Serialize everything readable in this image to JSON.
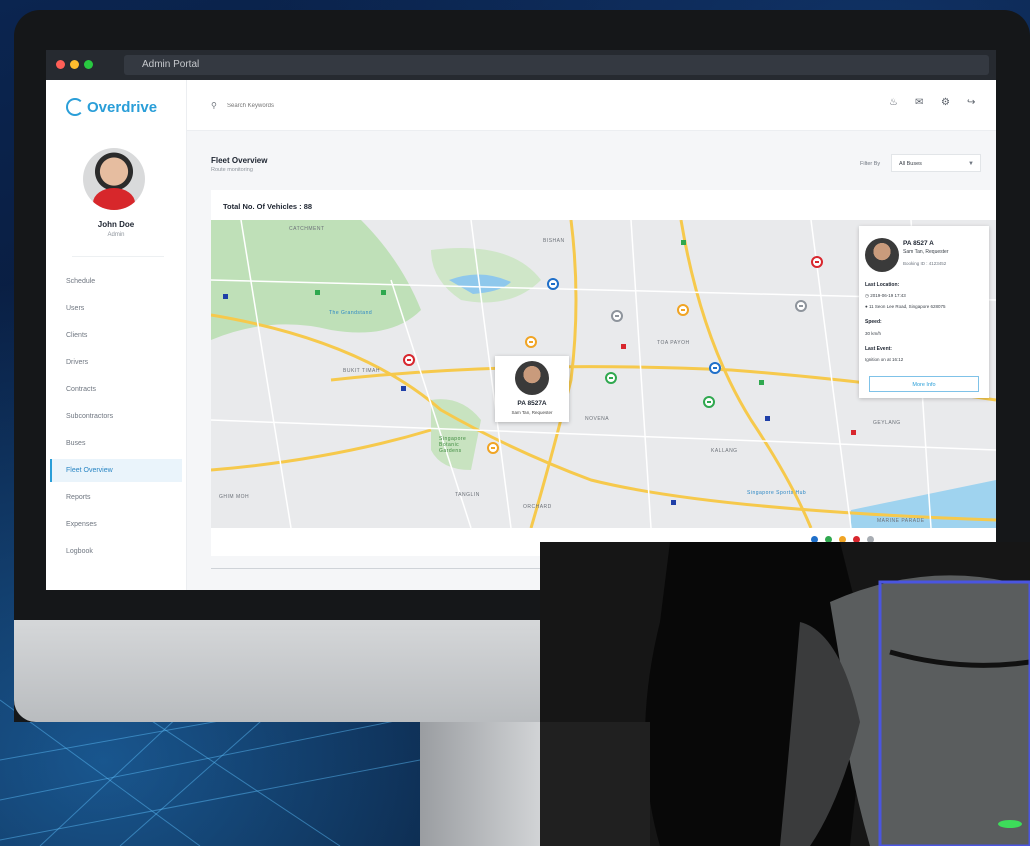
{
  "window": {
    "title": "Admin Portal"
  },
  "brand": {
    "name": "Overdrive",
    "accent": "#2a9ed8"
  },
  "user": {
    "name": "John Doe",
    "role": "Admin"
  },
  "nav": {
    "items": [
      {
        "label": "Schedule",
        "active": false
      },
      {
        "label": "Users",
        "active": false
      },
      {
        "label": "Clients",
        "active": false
      },
      {
        "label": "Drivers",
        "active": false
      },
      {
        "label": "Contracts",
        "active": false
      },
      {
        "label": "Subcontractors",
        "active": false
      },
      {
        "label": "Buses",
        "active": false
      },
      {
        "label": "Fleet Overview",
        "active": true
      },
      {
        "label": "Reports",
        "active": false
      },
      {
        "label": "Expenses",
        "active": false
      },
      {
        "label": "Logbook",
        "active": false
      }
    ]
  },
  "search": {
    "placeholder": "Search Keywords",
    "icon": "search-icon"
  },
  "topbar": {
    "icons": [
      "bell-icon",
      "mail-icon",
      "gear-icon",
      "logout-icon"
    ]
  },
  "page": {
    "title": "Fleet Overview",
    "subtitle": "Route monitoring"
  },
  "filter": {
    "label": "Filter By",
    "selected": "All Buses"
  },
  "fleet": {
    "total_label": "Total No. Of Vehicles : 88"
  },
  "map": {
    "labels": [
      "CATCHMENT",
      "BISHAN",
      "BUKIT TIMAH",
      "TOA PAYOH",
      "NOVENA",
      "KALLANG",
      "GEYLANG",
      "ORCHARD",
      "TANGLIN",
      "GHIM MOH",
      "MARINE PARADE",
      "The Grandstand",
      "Singapore Botanic Gardens",
      "Singapore Sports Hub"
    ],
    "popup": {
      "plate": "PA 8527A",
      "name": "Sam Tan, Requester"
    }
  },
  "info": {
    "plate": "PA 8527 A",
    "name": "Sam Tan, Requester",
    "booking": "Booking ID : 4123452",
    "last_location_label": "Last Location:",
    "time": "2019-06-19 17:43",
    "address": "11 Seon Lee Road, Singapore 628075",
    "speed_label": "Speed:",
    "speed": "30 km/h",
    "last_event_label": "Last Event:",
    "last_event": "Ignition on at 16:12",
    "more_button": "More Info"
  },
  "legend": [
    {
      "color": "#1f6fc9"
    },
    {
      "color": "#2fa84f"
    },
    {
      "color": "#f0a424"
    },
    {
      "color": "#d8262d"
    },
    {
      "color": "#a8adb3"
    }
  ]
}
